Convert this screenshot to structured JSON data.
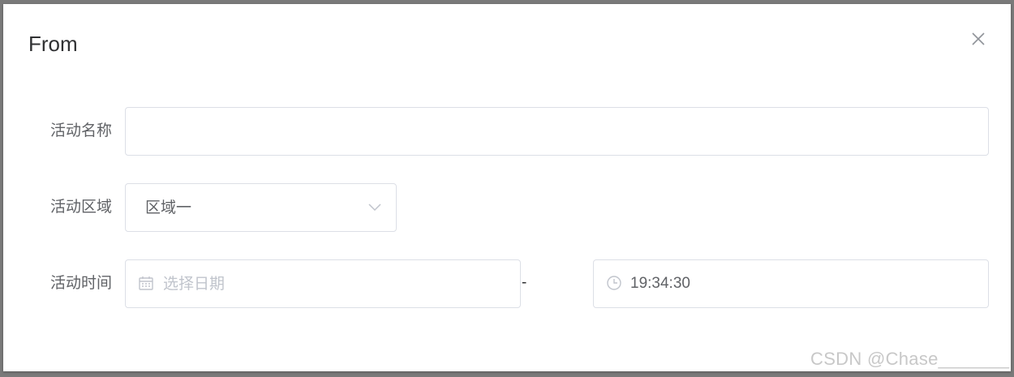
{
  "dialog": {
    "title": "From"
  },
  "form": {
    "name": {
      "label": "活动名称",
      "value": ""
    },
    "region": {
      "label": "活动区域",
      "selected": "区域一"
    },
    "time": {
      "label": "活动时间",
      "date_placeholder": "选择日期",
      "separator": "-",
      "time_value": "19:34:30"
    }
  },
  "watermark": "CSDN @Chase_______",
  "icons": {
    "close": "close-icon",
    "dropdown": "chevron-down-icon",
    "date": "calendar-icon",
    "time": "clock-icon"
  },
  "colors": {
    "overlay": "#7a7a7a",
    "border": "#dcdfe6",
    "label": "#606266",
    "placeholder": "#c0c4cc",
    "title": "#303133"
  }
}
